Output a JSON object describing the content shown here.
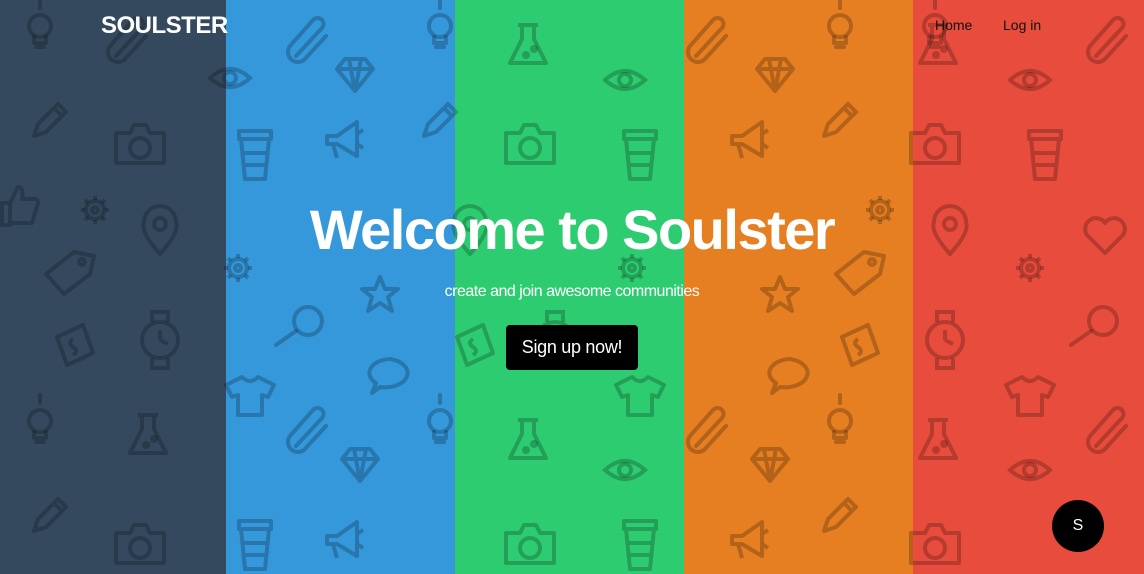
{
  "colors": {
    "stripes": [
      "#34495e",
      "#3498db",
      "#2ecc71",
      "#e67e22",
      "#e74c3c"
    ],
    "pattern_shade": "rgba(0,0,0,0.22)",
    "button_bg": "#000000",
    "fab_bg": "#000000"
  },
  "nav": {
    "brand": "SOULSTER",
    "links": [
      {
        "label": "Home"
      },
      {
        "label": "Log in"
      }
    ]
  },
  "hero": {
    "title": "Welcome to Soulster",
    "subtitle": "create and join awesome communities",
    "cta_label": "Sign up now!"
  },
  "fab": {
    "label": "S"
  },
  "background_icons": [
    "lightbulb-icon",
    "paperclip-icon",
    "flask-icon",
    "diamond-icon",
    "eye-icon",
    "pencil-icon",
    "camera-icon",
    "coffee-cup-icon",
    "megaphone-icon",
    "thumbs-up-icon",
    "gear-icon",
    "map-pin-icon",
    "tag-icon",
    "star-icon",
    "magnifier-icon",
    "watch-icon",
    "money-icon",
    "speech-bubble-icon",
    "t-shirt-icon",
    "heart-icon"
  ]
}
